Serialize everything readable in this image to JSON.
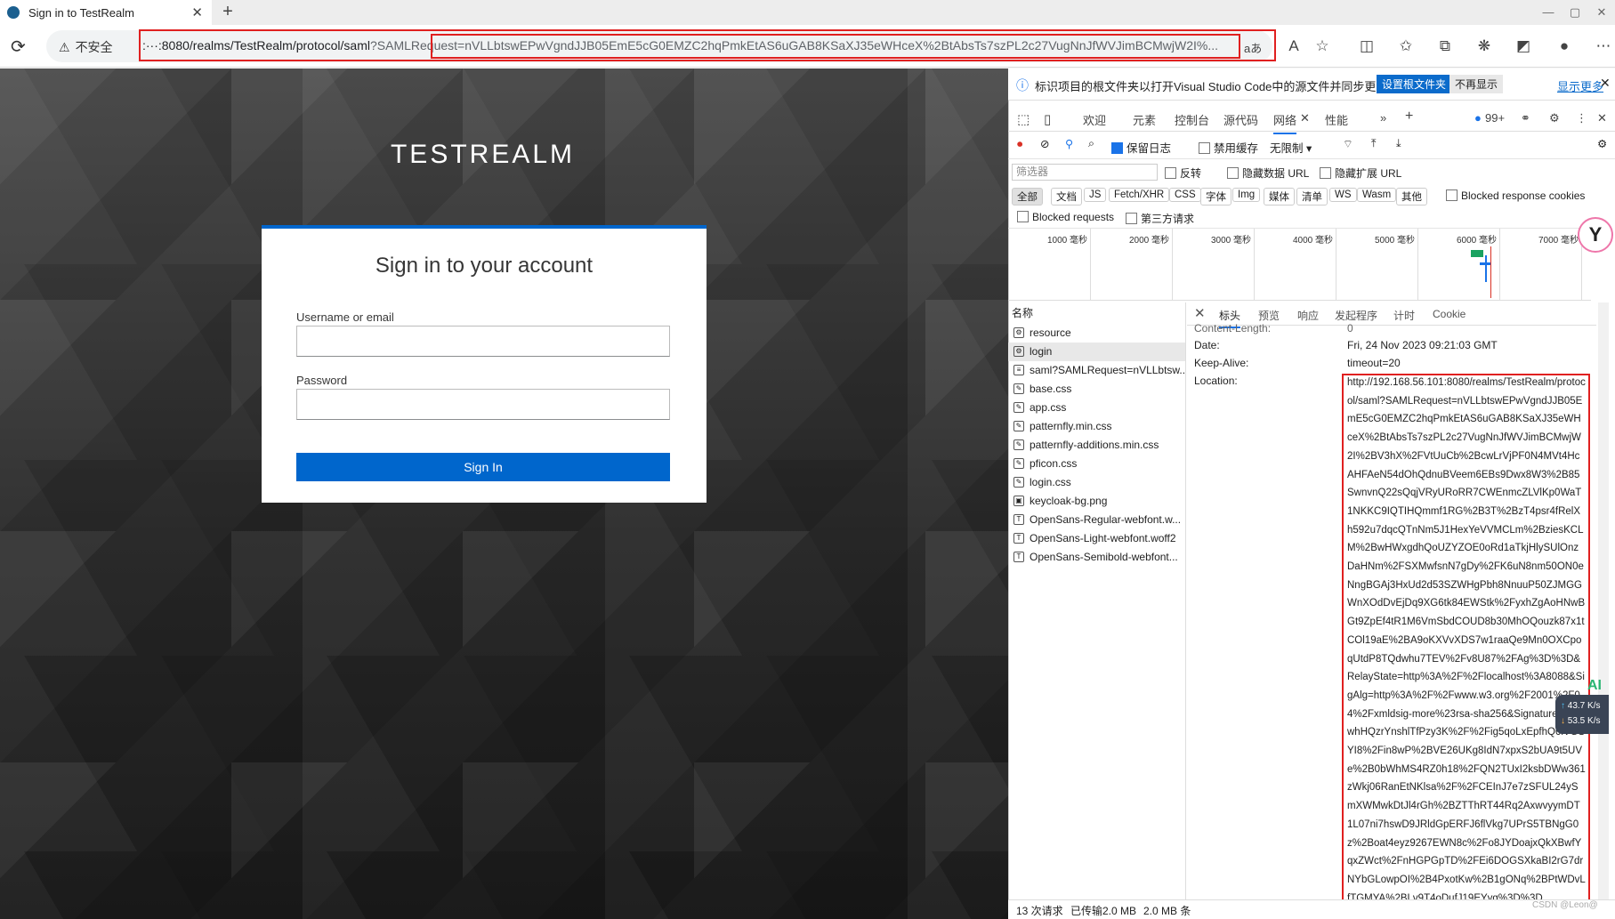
{
  "browser": {
    "tab_title": "Sign in to TestRealm",
    "tab_close": "✕",
    "new_tab": "+",
    "window_controls": [
      "—",
      "▢",
      "✕"
    ],
    "insecure_label": "不安全",
    "url_host": ":···:8080/realms/TestRealm/protocol/saml",
    "url_query": "?SAMLRequest=nVLLbtswEPwVgndJJB05EmE5cG0EMZC2hqPmkEtAS6uGAB8KSaXJ35eWHceX%2BtAbsTs7szPL2c27VugNnJfWVJimBCMwjW2I%...",
    "read_aloud_icon": "aあ"
  },
  "login": {
    "realm_title": "TESTREALM",
    "heading": "Sign in to your account",
    "username_label": "Username or email",
    "username_value": "",
    "password_label": "Password",
    "password_value": "",
    "sign_in_label": "Sign In"
  },
  "devtools": {
    "info_text": "标识项目的根文件夹以打开Visual Studio Code中的源文件并同步更改。",
    "info_btn_primary": "设置根文件夹",
    "info_btn_secondary": "不再显示",
    "info_more": "显示更多",
    "tabs": [
      "欢迎",
      "元素",
      "控制台",
      "源代码",
      "网络",
      "性能"
    ],
    "issues_badge": "99+",
    "net_preserve_log": "保留日志",
    "net_disable_cache": "禁用缓存",
    "net_throttle": "无限制",
    "filter_placeholder": "筛选器",
    "filter_invert": "反转",
    "filter_hide_data": "隐藏数据 URL",
    "filter_hide_ext": "隐藏扩展 URL",
    "filter_types": [
      "全部",
      "文档",
      "JS",
      "Fetch/XHR",
      "CSS",
      "字体",
      "Img",
      "媒体",
      "清单",
      "WS",
      "Wasm",
      "其他"
    ],
    "blocked_cookies": "Blocked response cookies",
    "blocked_requests": "Blocked requests",
    "third_party": "第三方请求",
    "timeline_ticks": [
      "1000 毫秒",
      "2000 毫秒",
      "3000 毫秒",
      "4000 毫秒",
      "5000 毫秒",
      "6000 毫秒",
      "7000 毫秒"
    ],
    "name_header": "名称",
    "requests": [
      {
        "name": "resource",
        "icon": "⚙"
      },
      {
        "name": "login",
        "icon": "⚙"
      },
      {
        "name": "saml?SAMLRequest=nVLLbtsw...",
        "icon": "≡"
      },
      {
        "name": "base.css",
        "icon": "✎"
      },
      {
        "name": "app.css",
        "icon": "✎"
      },
      {
        "name": "patternfly.min.css",
        "icon": "✎"
      },
      {
        "name": "patternfly-additions.min.css",
        "icon": "✎"
      },
      {
        "name": "pficon.css",
        "icon": "✎"
      },
      {
        "name": "login.css",
        "icon": "✎"
      },
      {
        "name": "keycloak-bg.png",
        "icon": "▣"
      },
      {
        "name": "OpenSans-Regular-webfont.w...",
        "icon": "T"
      },
      {
        "name": "OpenSans-Light-webfont.woff2",
        "icon": "T"
      },
      {
        "name": "OpenSans-Semibold-webfont...",
        "icon": "T"
      }
    ],
    "detail_tabs": [
      "标头",
      "预览",
      "响应",
      "发起程序",
      "计时",
      "Cookie"
    ],
    "headers": [
      {
        "name": "Content-Length:",
        "value": "0"
      },
      {
        "name": "Date:",
        "value": "Fri, 24 Nov 2023 09:21:03 GMT"
      },
      {
        "name": "Keep-Alive:",
        "value": "timeout=20"
      },
      {
        "name": "Location:",
        "value": ""
      }
    ],
    "location_value": "http://192.168.56.101:8080/realms/TestRealm/protocol/saml?SAMLRequest=nVLLbtswEPwVgndJJB05EmE5cG0EMZC2hqPmkEtAS6uGAB8KSaXJ35eWHceX%2BtAbsTs7szPL2c27VugNnJfWVJimBCMwjW2I%2BV3hX%2FVtUuCb%2BcwLrVjPF0N4MVt4HcAHFAeN54dOhQdnuBVeem6EBs9Dwx8W3%2B85SwnvnQ22sQqjVRyURoRR7CWEnmcZLVlKp0WaT1NKKC9IQTIHQmmf1RG%2B3T%2BzT4psr4fRelXh592u7dqcQTnNm5J1HexYeVVMCLm%2BziesKCLM%2BwHWxgdhQoUZYZOE0oRd1aTkjHlySUlOnzDaHNm%2FSXMwfsnN7gDy%2FK6uN8nm50ON0eNngBGAj3HxUd2d53SZWHgPbh8NnuuP50ZJMGGWnXOdDvEjDq9XG6tk84EWStk%2FyxhZgAoHNwBGt9ZpEf4tR1M6VmSbdCOUD8b30MhOQouzk87x1tCOl19aE%2BA9oKXVvXDS7w1raaQe9Mn0OXCpoqUtdP8TQdwhu7TEV%2Fv8U87%2FAg%3D%3D&RelayState=http%3A%2F%2Flocalhost%3A8088&SigAlg=http%3A%2F%2Fwww.w3.org%2F2001%2F04%2Fxmldsig-more%23rsa-sha256&Signature=Ylv4whHQzrYnshlTfPzy3K%2F%2Fig5qoLxEpfhQ6lVGSYI8%2Fin8wP%2BVE26UKg8IdN7xpxS2bUA9t5UVe%2B0bWhMS4RZ0h18%2FQN2TUxI2ksbDWw361zWkj06RanEtNKlsa%2F%2FCEInJ7e7zSFUL24ySmXWMwkDtJl4rGh%2BZTThRT44Rq2AxwvyymDT1L07ni7hswD9JRldGpERFJ6flVkg7UPrS5TBNgG0z%2Boat4eyz9267EWN8c%2Fo8JYDoajxQkXBwfYqxZWct%2FnHGPGpTD%2FEi6DOGSXkaBI2rG7drNYbGLowpOI%2B4PxotKw%2B1gONq%2BPtWDvLfTGMYA%2BLv9T4oDufJ19EYyg%3D%3D",
    "status_requests": "13 次请求",
    "status_transferred": "已传输2.0 MB",
    "status_size": "2.0 MB 条",
    "speed_up": "43.7 K/s",
    "speed_down": "53.5 K/s",
    "ai_badge": "AI",
    "watermark": "CSDN @Leon@"
  },
  "colors": {
    "keycloak_blue": "#0066cc",
    "annotation_red": "#e02020",
    "devtools_accent": "#1a73e8"
  }
}
